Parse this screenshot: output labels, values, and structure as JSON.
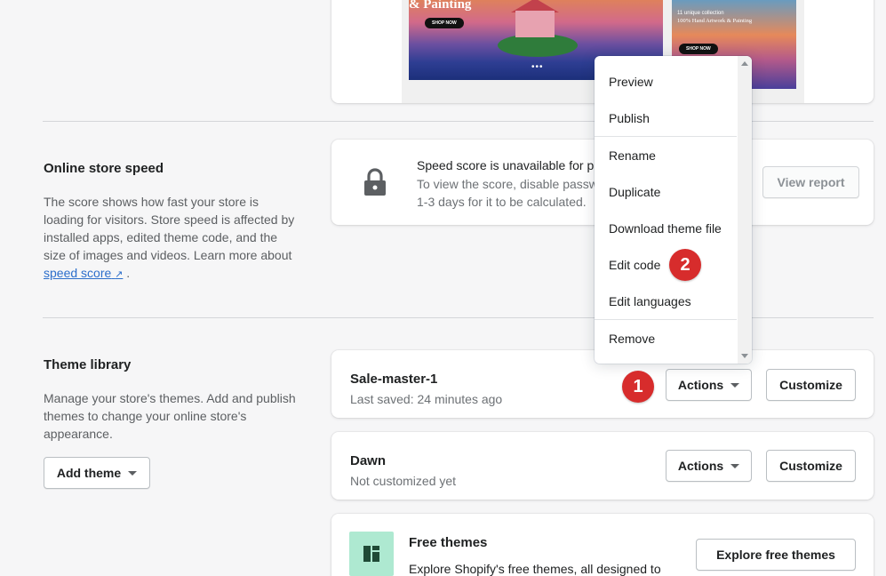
{
  "preview": {
    "desktop_title": "& Painting",
    "shop_now": "SHOP NOW",
    "mobile_tag": "11 unique collection",
    "mobile_title": "100% Hand Artwork & Painting",
    "dots": "•••"
  },
  "speed": {
    "title": "Online store speed",
    "desc_text": "The score shows how fast your store is loading for visitors. Store speed is affected by installed apps, edited theme code, and the size of images and videos. Learn more about",
    "link": "speed score",
    "period": ".",
    "card_heading": "Speed score is unavailable for pr",
    "card_body": "To view the score, disable passw",
    "card_body2": "1-3 days for it to be calculated.",
    "view_report": "View report",
    "icon": "lock-icon"
  },
  "library": {
    "title": "Theme library",
    "desc": "Manage your store's themes. Add and publish themes to change your online store's appearance.",
    "add_theme": "Add theme",
    "themes": [
      {
        "name": "Sale-master-1",
        "status": "Last saved: 24 minutes ago",
        "actions": "Actions",
        "customize": "Customize"
      },
      {
        "name": "Dawn",
        "status": "Not customized yet",
        "actions": "Actions",
        "customize": "Customize"
      }
    ],
    "free": {
      "title": "Free themes",
      "desc": "Explore Shopify's free themes, all designed to",
      "button": "Explore free themes",
      "icon": "theme-layout-icon",
      "icon_bg": "#aee9d1"
    }
  },
  "menu": {
    "items": [
      "Preview",
      "Publish",
      "Rename",
      "Duplicate",
      "Download theme file",
      "Edit code",
      "Edit languages",
      "Remove"
    ]
  },
  "badges": {
    "one": "1",
    "two": "2",
    "color": "#d72c2c"
  }
}
